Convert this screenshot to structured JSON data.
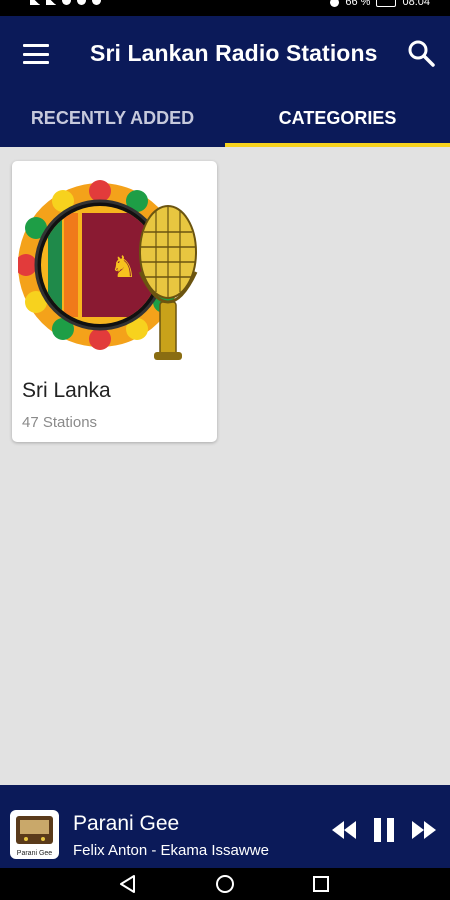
{
  "status_bar": {
    "time": "08:04",
    "battery": "66 %"
  },
  "app_bar": {
    "title": "Sri Lankan Radio Stations",
    "menu_icon": "hamburger-menu-icon",
    "search_icon": "search-icon"
  },
  "tabs": [
    {
      "label": "RECENTLY ADDED",
      "active": false
    },
    {
      "label": "CATEGORIES",
      "active": true
    }
  ],
  "categories": [
    {
      "title": "Sri Lanka",
      "subtitle": "47 Stations",
      "image": "sri-lanka-flag-microphone-image"
    }
  ],
  "player": {
    "station": "Parani Gee",
    "track": "Felix Anton - Ekama Issawwe",
    "thumb_label": "Parani Gee",
    "controls": [
      "rewind-icon",
      "pause-icon",
      "fast-forward-icon"
    ]
  },
  "nav_bar": {
    "buttons": [
      "back-icon",
      "home-icon",
      "recents-icon"
    ]
  },
  "colors": {
    "primary": "#0b1a59",
    "tab_indicator": "#f7d21e",
    "background": "#e2e2e2"
  }
}
